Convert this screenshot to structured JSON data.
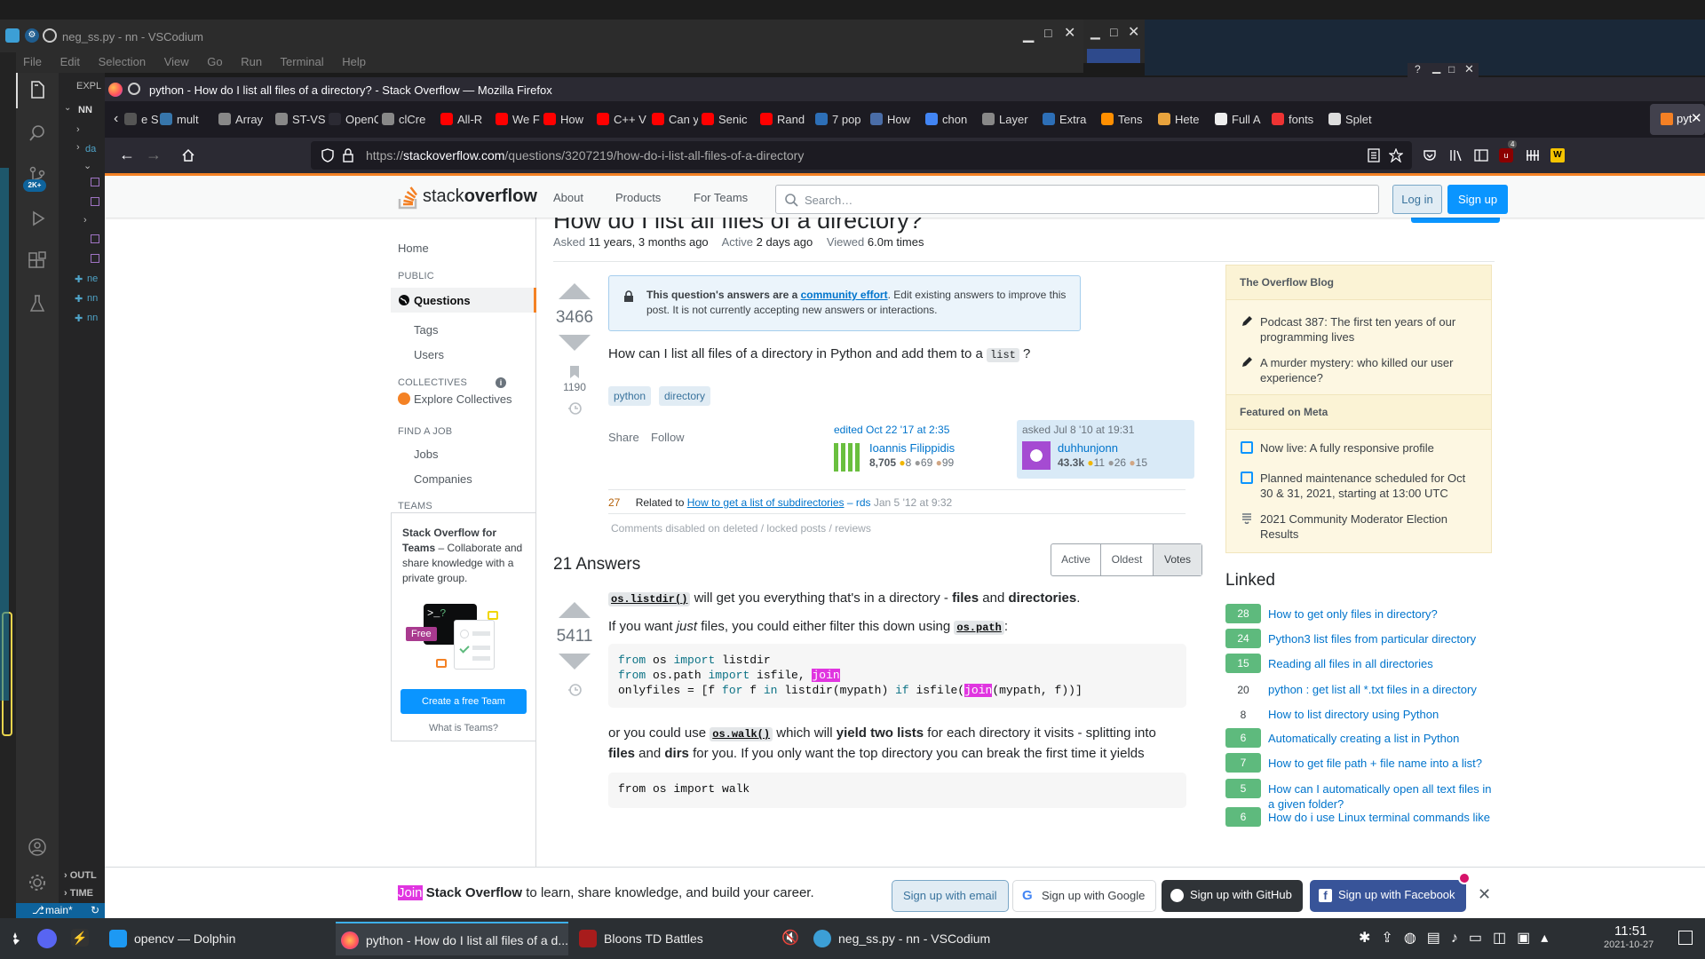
{
  "vscodium": {
    "title": "neg_ss.py - nn - VSCodium",
    "menu": [
      "File",
      "Edit",
      "Selection",
      "View",
      "Go",
      "Run",
      "Terminal",
      "Help"
    ],
    "explorer_label": "EXPL",
    "folder_label": "NN",
    "outline_label": "OUTL",
    "timeline_label": "TIME",
    "branch": "main*",
    "badge": "2K+",
    "files": [
      "ne",
      "nn",
      "nn"
    ]
  },
  "firefox": {
    "title": "python - How do I list all files of a directory? - Stack Overflow — Mozilla Firefox",
    "url_prefix": "https://",
    "url_host": "stackoverflow.com",
    "url_path": "/questions/3207219/how-do-i-list-all-files-of-a-directory",
    "addon_badge": "4",
    "tabs": [
      {
        "label": "e S",
        "color": "#555"
      },
      {
        "label": "mult",
        "color": "#3776ab"
      },
      {
        "label": "Array",
        "color": "#888"
      },
      {
        "label": "ST-VS",
        "color": "#888"
      },
      {
        "label": "OpenCL",
        "color": "#2b2a33"
      },
      {
        "label": "clCre",
        "color": "#888"
      },
      {
        "label": "All-R",
        "color": "#ff0000"
      },
      {
        "label": "We F",
        "color": "#ff0000"
      },
      {
        "label": "How",
        "color": "#ff0000"
      },
      {
        "label": "C++ V",
        "color": "#ff0000"
      },
      {
        "label": "Can y",
        "color": "#ff0000"
      },
      {
        "label": "Senic",
        "color": "#ff0000"
      },
      {
        "label": "Rand",
        "color": "#ff0000"
      },
      {
        "label": "7 pop",
        "color": "#2d6fb7"
      },
      {
        "label": "How",
        "color": "#4a6da7"
      },
      {
        "label": "chon",
        "color": "#4285f4"
      },
      {
        "label": "Layer",
        "color": "#888"
      },
      {
        "label": "Extra",
        "color": "#2d6fb7"
      },
      {
        "label": "Tens",
        "color": "#ff8f00"
      },
      {
        "label": "Hete",
        "color": "#e8a33d"
      },
      {
        "label": "Full A",
        "color": "#eee"
      },
      {
        "label": "fonts",
        "color": "#e33"
      },
      {
        "label": "Splet",
        "color": "#ddd"
      },
      {
        "label": "pyt",
        "color": "#f48024"
      }
    ]
  },
  "so": {
    "nav": [
      "About",
      "Products",
      "For Teams"
    ],
    "search_placeholder": "Search…",
    "login": "Log in",
    "signup": "Sign up",
    "left_nav": {
      "home": "Home",
      "public": "PUBLIC",
      "questions": "Questions",
      "tags": "Tags",
      "users": "Users",
      "collectives": "COLLECTIVES",
      "explore_collectives": "Explore Collectives",
      "find_job": "FIND A JOB",
      "jobs": "Jobs",
      "companies": "Companies",
      "teams": "TEAMS",
      "teams_title": "Stack Overflow for Teams",
      "teams_text": " – Collaborate and share knowledge with a private group.",
      "free": "Free",
      "create_team": "Create a free Team",
      "what_is_teams": "What is Teams?"
    },
    "question": {
      "title_partial": "How do I list all files of a directory?",
      "asked_label": "Asked",
      "asked_value": "11 years, 3 months ago",
      "active_label": "Active",
      "active_value": "2 days ago",
      "viewed_label": "Viewed",
      "viewed_value": "6.0m times",
      "votes": "3466",
      "bookmarks": "1190",
      "notice_bold": "This question's answers are a",
      "notice_link": "community effort",
      "notice_rest": ". Edit existing answers to improve this post. It is not currently accepting new answers or interactions.",
      "body_pre": "How can I list all files of a directory in Python and add them to a",
      "body_code": "list",
      "body_post": "?",
      "tags": [
        "python",
        "directory"
      ],
      "share": "Share",
      "follow": "Follow",
      "edited": "edited Oct 22 '17 at 2:35",
      "editor_name": "Ioannis Filippidis",
      "editor_rep": "8,705",
      "editor_gold": "8",
      "editor_silver": "69",
      "editor_bronze": "99",
      "asked_time": "asked Jul 8 '10 at 19:31",
      "asker_name": "duhhunjonn",
      "asker_rep": "43.3k",
      "asker_gold": "11",
      "asker_silver": "26",
      "asker_bronze": "15",
      "comment_score": "27",
      "comment_pre": "Related to",
      "comment_link": "How to get a list of subdirectories",
      "comment_user": "– rds",
      "comment_time": "Jan 5 '12 at 9:32",
      "comments_disabled": "Comments disabled on deleted / locked posts / reviews"
    },
    "answers": {
      "count": "21 Answers",
      "sort": [
        "Active",
        "Oldest",
        "Votes"
      ],
      "votes": "5411",
      "p1_code": "os.listdir()",
      "p1_text": " will get you everything that's in a directory - ",
      "p1_b1": "files",
      "p1_and": " and ",
      "p1_b2": "directories",
      "p1_end": ".",
      "p2_pre": "If you want ",
      "p2_em": "just",
      "p2_mid": " files, you could either filter this down using ",
      "p2_code": "os.path",
      "p2_end": ":",
      "code_l1_kw1": "from",
      "code_l1_a": " os ",
      "code_l1_kw2": "import",
      "code_l1_b": " listdir",
      "code_l2_kw1": "from",
      "code_l2_a": " os.path ",
      "code_l2_kw2": "import",
      "code_l2_b": " isfile, ",
      "code_join": "join",
      "code_l3_a": "onlyfiles = [f ",
      "code_l3_for": "for",
      "code_l3_b": " f ",
      "code_l3_in": "in",
      "code_l3_c": " listdir(mypath) ",
      "code_l3_if": "if",
      "code_l3_d": " isfile(",
      "code_l3_e": "(mypath, f))]",
      "p3_pre": "or you could use ",
      "p3_code": "os.walk()",
      "p3_mid": " which will ",
      "p3_b": "yield two lists",
      "p3_mid2": " for each directory it visits - splitting into ",
      "p3_b2": "files",
      "p3_and": " and ",
      "p3_b3": "dirs",
      "p3_end": " for you. If you only want the top directory you can break the first time it yields",
      "code2_partial": "from os import walk"
    },
    "sidebar": {
      "blog_title": "The Overflow Blog",
      "blog_items": [
        "Podcast 387: The first ten years of our programming lives",
        "A murder mystery: who killed our user experience?"
      ],
      "meta_title": "Featured on Meta",
      "meta_items": [
        "Now live: A fully responsive profile",
        "Planned maintenance scheduled for Oct 30 & 31, 2021, starting at 13:00 UTC",
        "2021 Community Moderator Election Results"
      ],
      "linked_title": "Linked",
      "linked": [
        {
          "score": "28",
          "title": "How to get only files in directory?",
          "accepted": true
        },
        {
          "score": "24",
          "title": "Python3 list files from particular directory",
          "accepted": true
        },
        {
          "score": "15",
          "title": "Reading all files in all directories",
          "accepted": true
        },
        {
          "score": "20",
          "title": "python : get list all *.txt files in a directory",
          "accepted": false
        },
        {
          "score": "8",
          "title": "How to list directory using Python",
          "accepted": false
        },
        {
          "score": "6",
          "title": "Automatically creating a list in Python",
          "accepted": true
        },
        {
          "score": "7",
          "title": "How to get file path + file name into a list?",
          "accepted": true
        },
        {
          "score": "5",
          "title": "How can I automatically open all text files in a given folder?",
          "accepted": true
        },
        {
          "score": "6",
          "title": "How do i use Linux terminal commands like",
          "accepted": true
        }
      ]
    },
    "banner": {
      "join": "Join",
      "brand": "Stack Overflow",
      "text": " to learn, share knowledge, and build your career.",
      "email": "Sign up with email",
      "google": "Sign up with Google",
      "github": "Sign up with GitHub",
      "facebook": "Sign up with Facebook"
    }
  },
  "taskbar": {
    "items": [
      "opencv — Dolphin",
      "python - How do I list all files of a d...",
      "Bloons TD Battles",
      "neg_ss.py - nn - VSCodium"
    ],
    "time": "11:51",
    "date": "2021-10-27"
  }
}
